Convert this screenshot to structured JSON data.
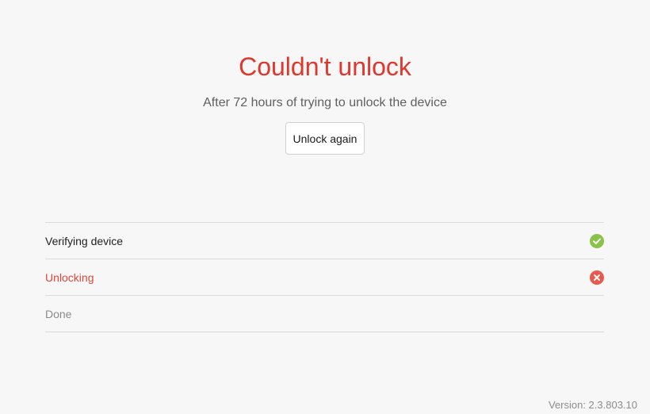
{
  "page": {
    "title": "Couldn't unlock",
    "subtitle": "After 72 hours of trying to unlock the device",
    "retry_button_label": "Unlock again"
  },
  "steps": [
    {
      "label": "Verifying device",
      "status": "success",
      "icon": "check-circle-icon",
      "color": "#8bc34a"
    },
    {
      "label": "Unlocking",
      "status": "failed",
      "icon": "close-circle-icon",
      "color": "#e9594c"
    },
    {
      "label": "Done",
      "status": "pending"
    }
  ],
  "footer": {
    "version": "Version: 2.3.803.10"
  },
  "colors": {
    "accent_error": "#e0362c",
    "success": "#8bc34a",
    "background": "#f7f7f7"
  }
}
